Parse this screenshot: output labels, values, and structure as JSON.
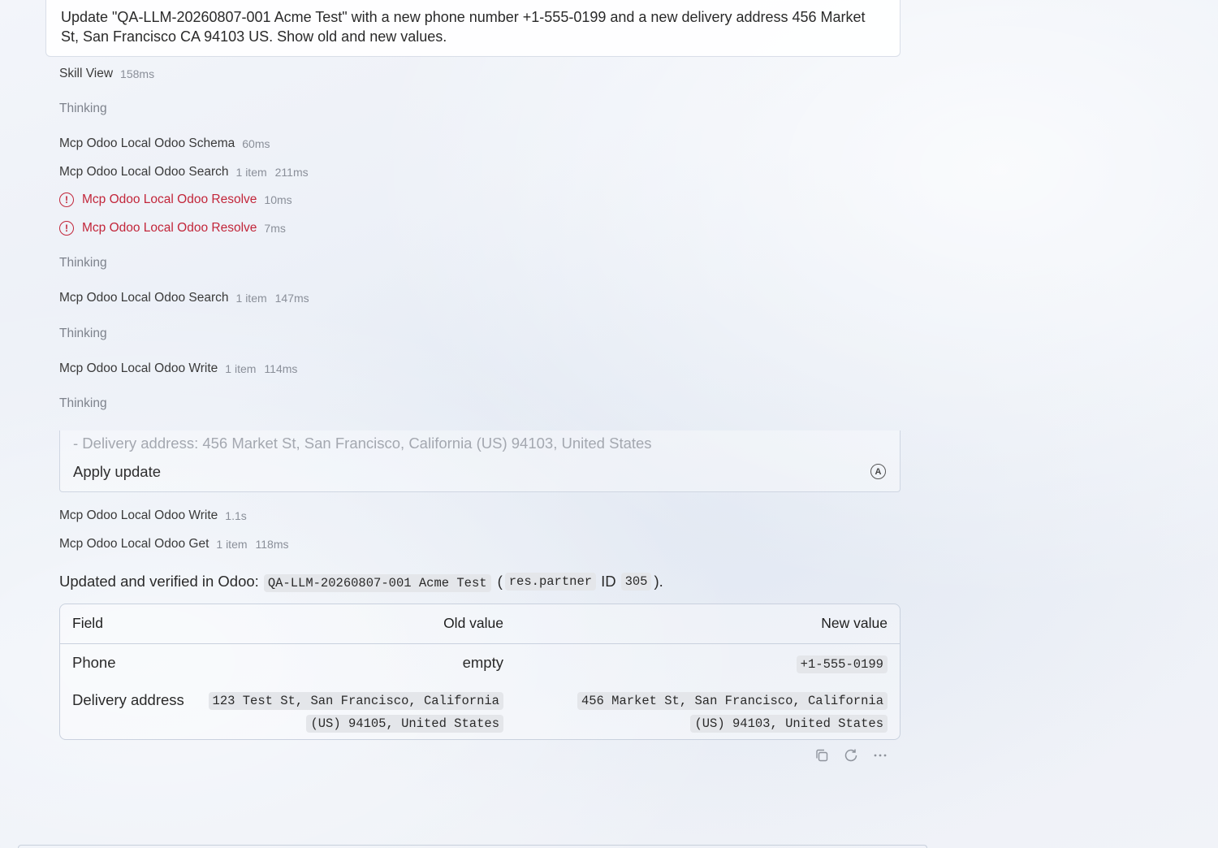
{
  "user_message": "Update \"QA-LLM-20260807-001 Acme Test\" with a new phone number +1-555-0199 and a new delivery address 456 Market St, San Francisco CA 94103 US. Show old and new values.",
  "steps": [
    {
      "name": "Skill View",
      "meta": "158ms",
      "meta2": "",
      "status": "ok"
    },
    {
      "name": "Thinking",
      "meta": "",
      "meta2": "",
      "status": "thinking"
    },
    {
      "name": "Mcp Odoo Local Odoo Schema",
      "meta": "60ms",
      "meta2": "",
      "status": "ok"
    },
    {
      "name": "Mcp Odoo Local Odoo Search",
      "meta": "1 item",
      "meta2": "211ms",
      "status": "ok"
    },
    {
      "name": "Mcp Odoo Local Odoo Resolve",
      "meta": "10ms",
      "meta2": "",
      "status": "error"
    },
    {
      "name": "Mcp Odoo Local Odoo Resolve",
      "meta": "7ms",
      "meta2": "",
      "status": "error"
    },
    {
      "name": "Thinking",
      "meta": "",
      "meta2": "",
      "status": "thinking"
    },
    {
      "name": "Mcp Odoo Local Odoo Search",
      "meta": "1 item",
      "meta2": "147ms",
      "status": "ok"
    },
    {
      "name": "Thinking",
      "meta": "",
      "meta2": "",
      "status": "thinking"
    },
    {
      "name": "Mcp Odoo Local Odoo Write",
      "meta": "1 item",
      "meta2": "114ms",
      "status": "ok"
    },
    {
      "name": "Thinking",
      "meta": "",
      "meta2": "",
      "status": "thinking"
    },
    {
      "name": "Mcp Odoo Local Odoo Write",
      "meta": "1.1s",
      "meta2": "",
      "status": "ok"
    },
    {
      "name": "Mcp Odoo Local Odoo Get",
      "meta": "1 item",
      "meta2": "118ms",
      "status": "ok"
    }
  ],
  "approval": {
    "faded_text": "- Delivery address: 456 Market St, San Francisco, California (US) 94103, United States",
    "label": "Apply update",
    "icon_letter": "A"
  },
  "summary": {
    "prefix": "Updated and verified in Odoo:",
    "record_name": "QA-LLM-20260807-001 Acme Test",
    "open_paren": "(",
    "model": "res.partner",
    "id_label": "ID",
    "id_value": "305",
    "close_paren": ")."
  },
  "table": {
    "headers": [
      "Field",
      "Old value",
      "New value"
    ],
    "rows": [
      {
        "field": "Phone",
        "old": "empty",
        "new": "+1-555-0199"
      },
      {
        "field": "Delivery address",
        "old_line1": "123 Test St, San Francisco, California",
        "old_line2": "(US) 94105, United States",
        "new_line1": "456 Market St, San Francisco, California",
        "new_line2": "(US) 94103, United States"
      }
    ]
  },
  "actions": [
    {
      "icon": "copy-icon"
    },
    {
      "icon": "refresh-icon"
    },
    {
      "icon": "more-icon"
    }
  ],
  "colors": {
    "error": "#c2263a",
    "muted": "#8a8f99",
    "border": "#c9d1de"
  }
}
